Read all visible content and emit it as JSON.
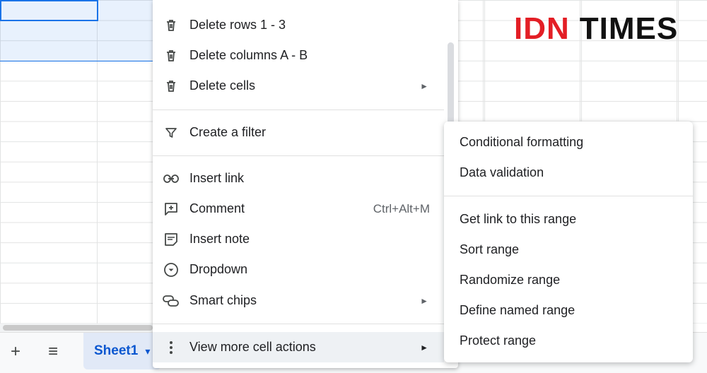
{
  "context_menu": {
    "items": [
      {
        "label": "Delete rows 1 - 3",
        "icon": "trash-icon"
      },
      {
        "label": "Delete columns A - B",
        "icon": "trash-icon"
      },
      {
        "label": "Delete cells",
        "icon": "trash-icon",
        "submenu_arrow": "►"
      },
      {
        "label": "Create a filter",
        "icon": "filter-icon"
      },
      {
        "label": "Insert link",
        "icon": "link-icon"
      },
      {
        "label": "Comment",
        "icon": "add-comment-icon",
        "shortcut": "Ctrl+Alt+M"
      },
      {
        "label": "Insert note",
        "icon": "note-icon"
      },
      {
        "label": "Dropdown",
        "icon": "dropdown-icon"
      },
      {
        "label": "Smart chips",
        "icon": "smart-chip-icon",
        "submenu_arrow": "►"
      },
      {
        "label": "View more cell actions",
        "icon": "more-vert-icon",
        "submenu_arrow": "►"
      }
    ]
  },
  "submenu": {
    "items": [
      {
        "label": "Conditional formatting"
      },
      {
        "label": "Data validation"
      },
      {
        "label": "Get link to this range"
      },
      {
        "label": "Sort range"
      },
      {
        "label": "Randomize range"
      },
      {
        "label": "Define named range"
      },
      {
        "label": "Protect range"
      }
    ]
  },
  "sheet_bar": {
    "add_label": "+",
    "list_label": "≡",
    "tab_label": "Sheet1",
    "tab_arrow": "▾"
  },
  "watermark": {
    "part1": "IDN",
    "part2": "TIMES"
  },
  "colors": {
    "selection": "#1a73e8",
    "sheet_tab_text": "#0b57d0",
    "logo_red": "#e31e25"
  }
}
